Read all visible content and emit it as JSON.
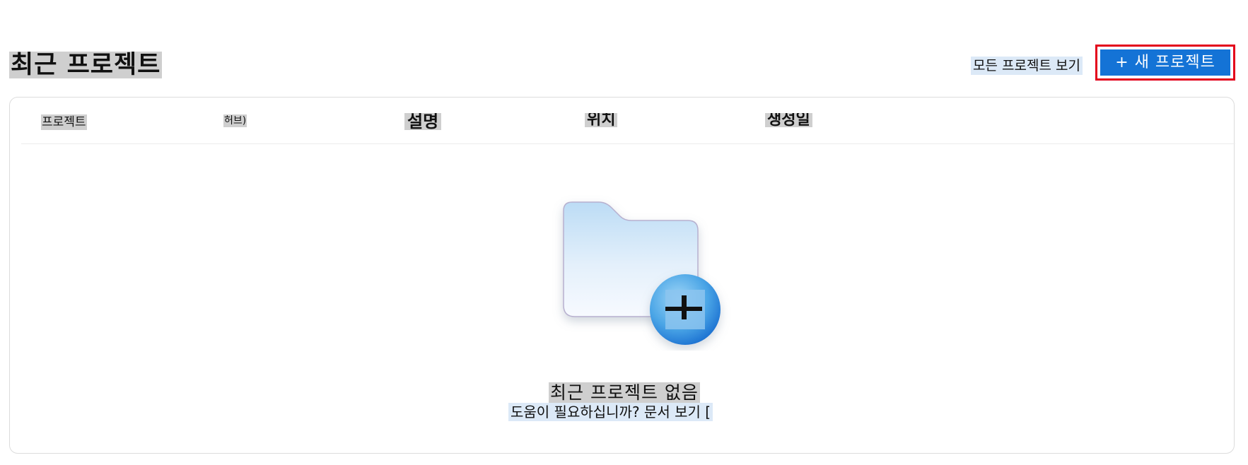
{
  "header": {
    "title": "최근 프로젝트",
    "view_all_label": "모든 프로젝트 보기",
    "new_project_label": "+ 새 프로젝트"
  },
  "table": {
    "columns": [
      "프로젝트",
      "허브)",
      "설명",
      "위치",
      "생성일"
    ],
    "rows": []
  },
  "empty_state": {
    "icon": "folder-add-icon",
    "title": "최근 프로젝트 없음",
    "help_text": "도움이 필요하십니까? 문서 보기 ["
  },
  "colors": {
    "primary_button": "#1473d6",
    "highlight_outline": "#e3001b"
  }
}
